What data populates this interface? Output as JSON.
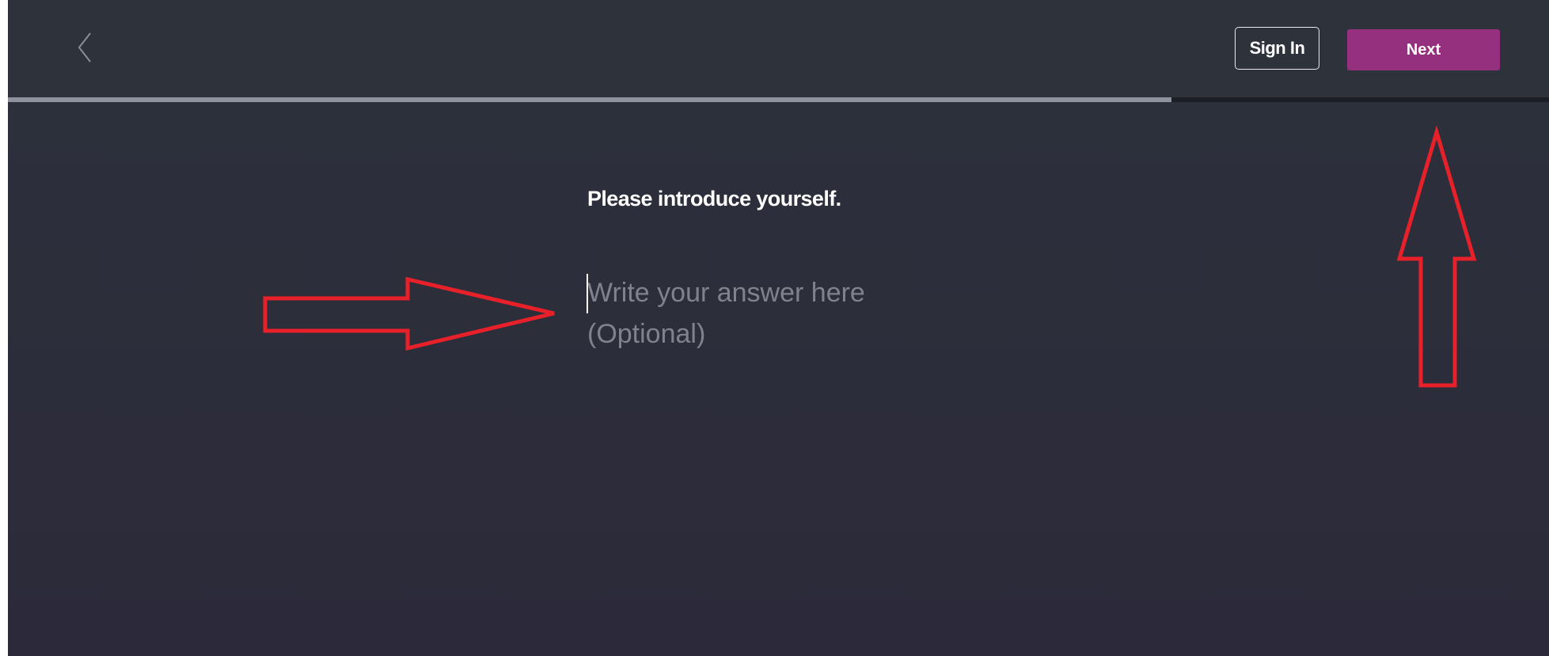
{
  "window": {
    "background_top": "#2c313b",
    "background_bottom": "#2c2a3a"
  },
  "header": {
    "back_icon": "chevron-left-icon",
    "back_icon_color": "#8a8e98",
    "signin_label": "Sign In",
    "next_label": "Next",
    "accent": "#95307f"
  },
  "progress": {
    "fraction": 0.755,
    "fill_color": "#8e939d"
  },
  "question": {
    "title": "Please introduce yourself.",
    "answer_value": "",
    "answer_placeholder": "Write your answer here\n(Optional)"
  },
  "annotations": {
    "color": "#e8202a",
    "items": [
      {
        "icon": "right-arrow-icon",
        "points_to": "answer-input"
      },
      {
        "icon": "up-arrow-icon",
        "points_to": "next-button"
      }
    ]
  }
}
